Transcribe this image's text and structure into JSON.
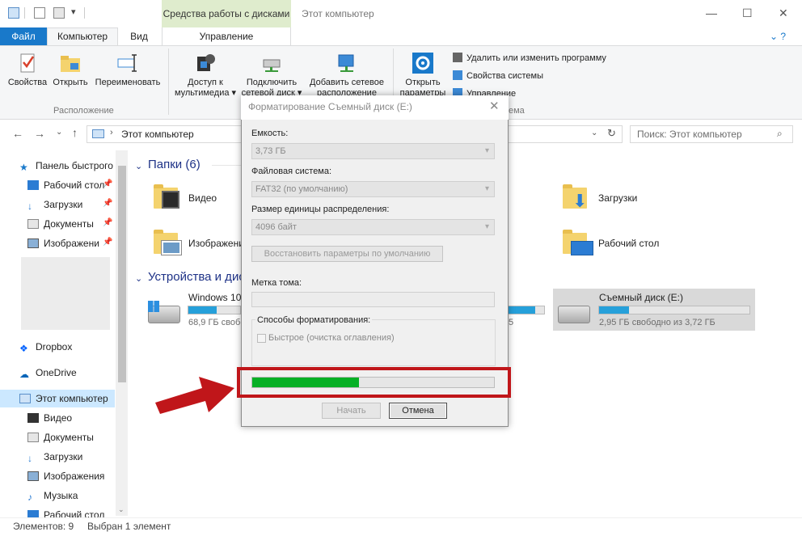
{
  "titlebar": {
    "tools_tab": "Средства работы с дисками",
    "title": "Этот компьютер",
    "minimize": "—",
    "maximize": "☐",
    "close": "✕"
  },
  "tabs": {
    "file": "Файл",
    "computer": "Компьютер",
    "view": "Вид",
    "manage": "Управление"
  },
  "ribbon": {
    "properties": "Свойства",
    "open": "Открыть",
    "rename": "Переименовать",
    "group_location": "Расположение",
    "media_access_1": "Доступ к",
    "media_access_2": "мультимедиа ▾",
    "map_drive_1": "Подключить",
    "map_drive_2": "сетевой диск ▾",
    "add_location_1": "Добавить сетевое",
    "add_location_2": "расположение",
    "open_settings_1": "Открыть",
    "open_settings_2": "параметры",
    "uninstall": "Удалить или изменить программу",
    "system_props": "Свойства системы",
    "manage": "Управление",
    "group_system_partial": "ема"
  },
  "address": {
    "path": "Этот компьютер",
    "search_placeholder": "Поиск: Этот компьютер"
  },
  "nav": {
    "quick_access": "Панель быстрого",
    "desktop": "Рабочий стол",
    "downloads": "Загрузки",
    "documents": "Документы",
    "pictures": "Изображени",
    "dropbox": "Dropbox",
    "onedrive": "OneDrive",
    "this_pc": "Этот компьютер",
    "videos": "Видео",
    "documents2": "Документы",
    "downloads2": "Загрузки",
    "pictures2": "Изображения",
    "music": "Музыка",
    "desktop2": "Рабочий стол"
  },
  "content": {
    "folders_header": "Папки (6)",
    "folder_video": "Видео",
    "folder_downloads": "Загрузки",
    "folder_pictures": "Изображени",
    "folder_desktop": "Рабочий стол",
    "devices_header": "Устройства и дис",
    "drive_c_name": "Windows 10",
    "drive_c_free": "68,9 ГБ свобо",
    "drive_c_used_fraction": 0.55,
    "drive_mid_partial": "5",
    "drive_mid_used_fraction": 0.75,
    "drive_e_name": "Съемный диск (E:)",
    "drive_e_free": "2,95 ГБ свободно из 3,72 ГБ",
    "drive_e_used_fraction": 0.2
  },
  "status": {
    "items": "Элементов: 9",
    "selected": "Выбран 1 элемент"
  },
  "dialog": {
    "title": "Форматирование Съемный диск (E:)",
    "capacity_label": "Емкость:",
    "capacity_value": "3,73 ГБ",
    "fs_label": "Файловая система:",
    "fs_value": "FAT32 (по умолчанию)",
    "alloc_label": "Размер единицы распределения:",
    "alloc_value": "4096 байт",
    "restore_defaults": "Восстановить параметры по умолчанию",
    "volume_label": "Метка тома:",
    "volume_value": "",
    "format_options": "Способы форматирования:",
    "quick_format": "Быстрое (очистка оглавления)",
    "progress_fraction": 0.44,
    "start": "Начать",
    "cancel": "Отмена"
  },
  "colors": {
    "accent": "#1979ca",
    "progress": "#06b025",
    "highlight": "#c0161a",
    "arrow": "#c0161a"
  }
}
